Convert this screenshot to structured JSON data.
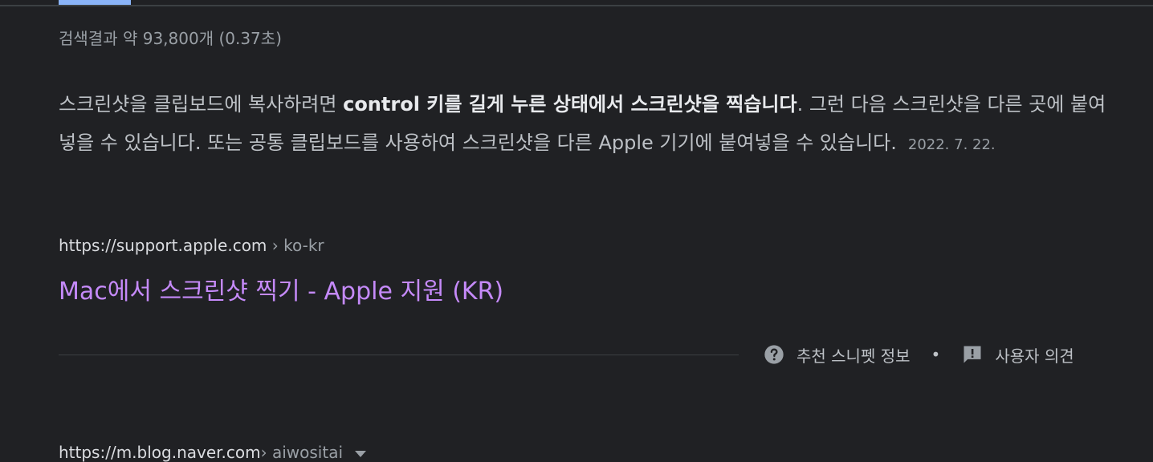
{
  "stats": {
    "text": "검색결과 약 93,800개 (0.37초)"
  },
  "snippet": {
    "part1": "스크린샷을 클립보드에 복사하려면 ",
    "bold": "control 키를 길게 누른 상태에서 스크린샷을 찍습니다",
    "part2": ". 그런 다음 스크린샷을 다른 곳에 붙여넣을 수 있습니다. 또는 공통 클립보드를 사용하여 스크린샷을 다른 Apple 기기에 붙여넣을 수 있습니다.",
    "date": "2022. 7. 22."
  },
  "result": {
    "url_domain": "https://support.apple.com",
    "url_crumb": " › ko-kr",
    "title": "Mac에서 스크린샷 찍기 - Apple 지원 (KR)"
  },
  "footer": {
    "about_label": "추천 스니펫 정보",
    "separator": "•",
    "feedback_label": "사용자 의견",
    "about_icon": "help-circle-icon",
    "feedback_icon": "feedback-icon"
  },
  "next_result": {
    "url_domain": "https://m.blog.naver.com",
    "url_crumb": " › aiwositai",
    "menu_icon": "caret-down-icon"
  },
  "colors": {
    "background": "#202124",
    "visited_link": "#c58af9",
    "text": "#bdc1c6",
    "muted": "#9aa0a6",
    "active_tab": "#8ab4f8"
  }
}
